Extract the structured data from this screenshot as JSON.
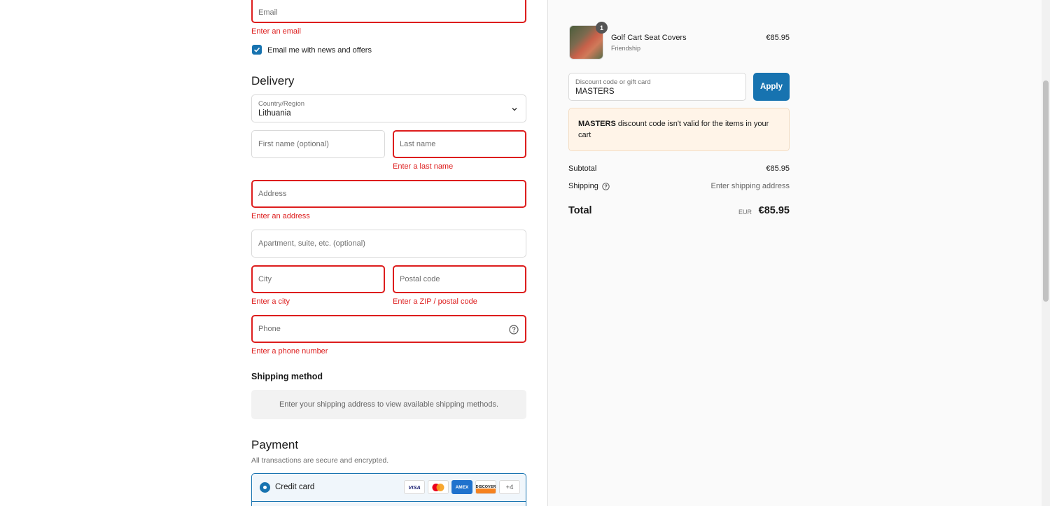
{
  "contact": {
    "email_placeholder": "Email",
    "email_error": "Enter an email",
    "newsletter_label": "Email me with news and offers"
  },
  "delivery": {
    "heading": "Delivery",
    "country_label": "Country/Region",
    "country_value": "Lithuania",
    "first_name_placeholder": "First name (optional)",
    "last_name_placeholder": "Last name",
    "last_name_error": "Enter a last name",
    "address_placeholder": "Address",
    "address_error": "Enter an address",
    "apartment_placeholder": "Apartment, suite, etc. (optional)",
    "city_placeholder": "City",
    "city_error": "Enter a city",
    "postal_placeholder": "Postal code",
    "postal_error": "Enter a ZIP / postal code",
    "phone_placeholder": "Phone",
    "phone_error": "Enter a phone number"
  },
  "shipping_method": {
    "heading": "Shipping method",
    "message": "Enter your shipping address to view available shipping methods."
  },
  "payment": {
    "heading": "Payment",
    "subtitle": "All transactions are secure and encrypted.",
    "method_label": "Credit card",
    "cards": [
      "VISA",
      "MC",
      "AMEX",
      "DISCOVER"
    ],
    "more_cards": "+4"
  },
  "summary": {
    "product": {
      "quantity": "1",
      "name": "Golf Cart Seat Covers",
      "variant": "Friendship",
      "price": "€85.95"
    },
    "discount": {
      "label": "Discount code or gift card",
      "value": "MASTERS",
      "apply_label": "Apply",
      "notice_code": "MASTERS",
      "notice_text": " discount code isn't valid for the items in your cart"
    },
    "subtotal_label": "Subtotal",
    "subtotal_value": "€85.95",
    "shipping_label": "Shipping",
    "shipping_value": "Enter shipping address",
    "total_label": "Total",
    "total_currency": "EUR",
    "total_value": "€85.95"
  },
  "colors": {
    "accent": "#1773b0",
    "error": "#dd1d1d",
    "notice_bg": "#fff4e8"
  }
}
